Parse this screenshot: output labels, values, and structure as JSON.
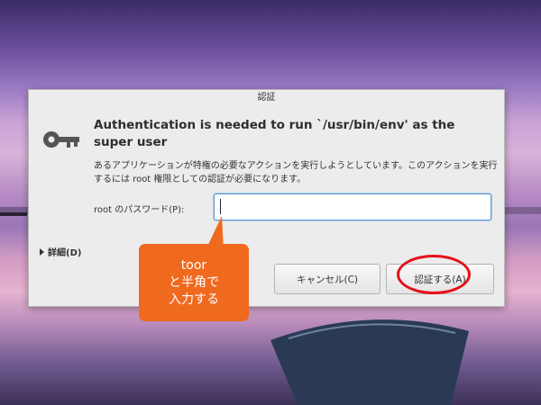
{
  "dialog": {
    "title": "認証",
    "heading": "Authentication is needed to run `/usr/bin/env' as the super user",
    "description": "あるアプリケーションが特権の必要なアクションを実行しようとしています。このアクションを実行するには root 権限としての認証が必要になります。",
    "password_label": "root のパスワード(P):",
    "password_value": "",
    "details_label": "詳細(D)",
    "cancel_label": "キャンセル(C)",
    "authenticate_label": "認証する(A)",
    "icon": "key-icon"
  },
  "annotation": {
    "callout_lines": [
      "toor",
      "と半角で",
      "入力する"
    ],
    "callout_color": "#ef6a1f",
    "highlight_color": "#e5101a"
  }
}
